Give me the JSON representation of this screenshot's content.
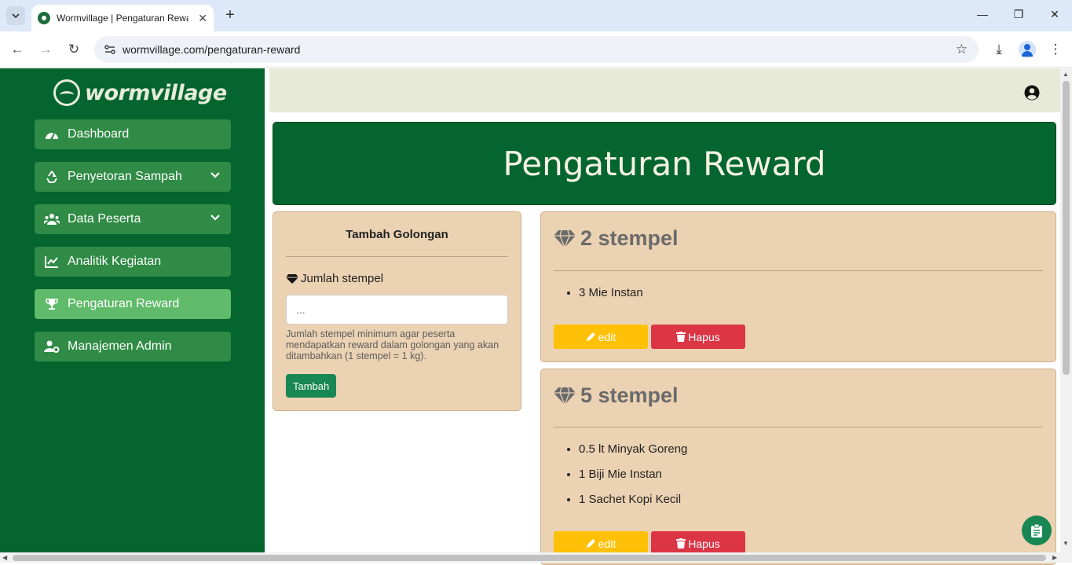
{
  "browser": {
    "tab_title": "Wormvillage | Pengaturan Rewa",
    "url": "wormvillage.com/pengaturan-reward"
  },
  "sidebar": {
    "logo_text": "wormvillage",
    "items": [
      {
        "label": "Dashboard",
        "icon": "gauge-icon",
        "has_chevron": false,
        "active": false
      },
      {
        "label": "Penyetoran Sampah",
        "icon": "recycle-icon",
        "has_chevron": true,
        "active": false
      },
      {
        "label": "Data Peserta",
        "icon": "users-icon",
        "has_chevron": true,
        "active": false
      },
      {
        "label": "Analitik Kegiatan",
        "icon": "line-chart-icon",
        "has_chevron": false,
        "active": false
      },
      {
        "label": "Pengaturan Reward",
        "icon": "trophy-icon",
        "has_chevron": false,
        "active": true
      },
      {
        "label": "Manajemen Admin",
        "icon": "user-gear-icon",
        "has_chevron": false,
        "active": false
      }
    ]
  },
  "page": {
    "title": "Pengaturan Reward"
  },
  "form": {
    "title": "Tambah Golongan",
    "label": "Jumlah stempel",
    "placeholder": "...",
    "help": "Jumlah stempel minimum agar peserta mendapatkan reward dalam golongan yang akan ditambahkan (1 stempel = 1 kg).",
    "submit_label": "Tambah"
  },
  "rewards": [
    {
      "title": "2 stempel",
      "items": [
        "3 Mie Instan"
      ],
      "edit_label": "edit",
      "delete_label": "Hapus"
    },
    {
      "title": "5 stempel",
      "items": [
        "0.5 lt Minyak Goreng",
        "1 Biji Mie Instan",
        "1 Sachet Kopi Kecil"
      ],
      "edit_label": "edit",
      "delete_label": "Hapus"
    }
  ],
  "colors": {
    "sidebar_bg": "#04652f",
    "menu_item": "#2f8b45",
    "menu_active": "#5fbb69",
    "card_bg": "#ebd2b2",
    "edit_btn": "#ffc107",
    "delete_btn": "#dc3545",
    "primary_btn": "#198754"
  }
}
